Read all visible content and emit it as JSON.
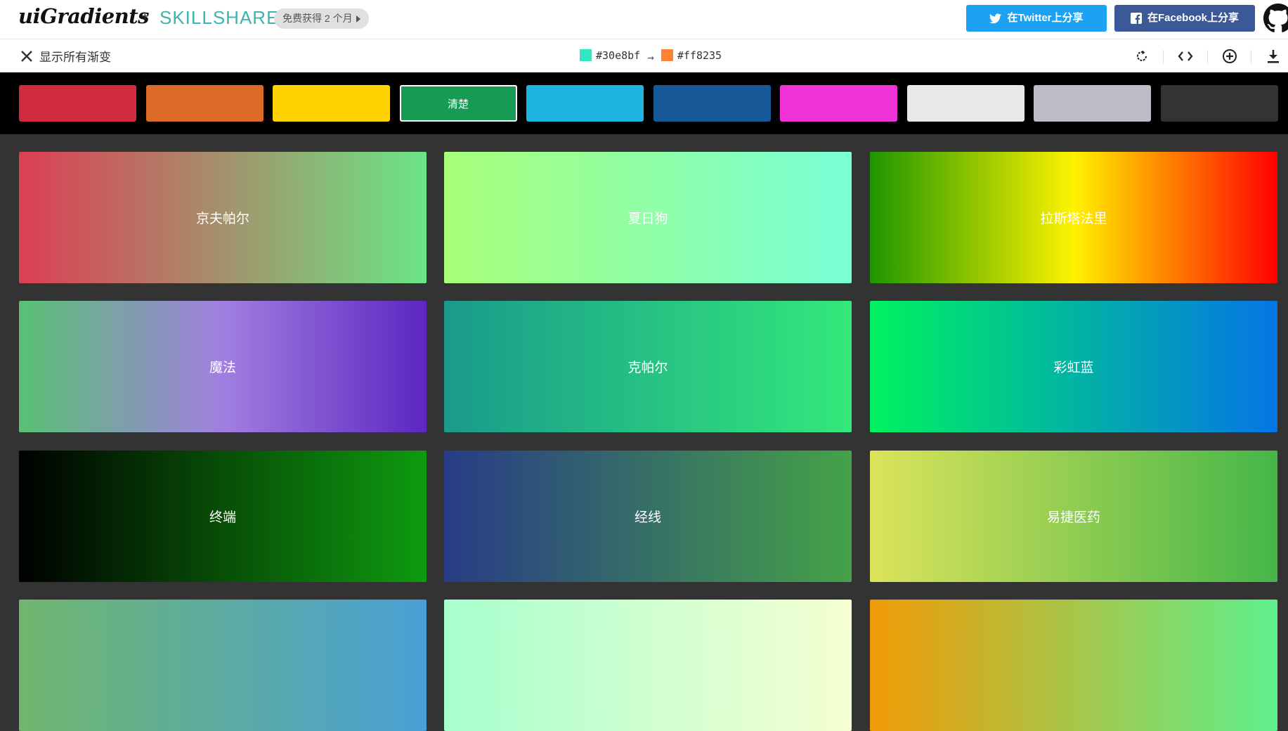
{
  "header": {
    "brand": "uiGradients",
    "plus": "+",
    "partner": "SKILLSHARE",
    "promo_label": "免费获得 2 个月",
    "share_twitter_label": "在Twitter上分享",
    "share_facebook_label": "在Facebook上分享",
    "icons": [
      "twitter-icon",
      "facebook-icon",
      "github-icon"
    ]
  },
  "toolbar": {
    "show_all_label": "显示所有渐变",
    "from_color": "#30e8bf",
    "to_color": "#ff8235",
    "arrow": "→",
    "tools": [
      "rotate-icon",
      "code-icon",
      "add-icon",
      "download-icon"
    ]
  },
  "filters": [
    {
      "color": "#d02b3e",
      "label": ""
    },
    {
      "color": "#dc6b27",
      "label": ""
    },
    {
      "color": "#ffd200",
      "label": ""
    },
    {
      "color": "#169b54",
      "label": "清楚",
      "active": true
    },
    {
      "color": "#1fb4e0",
      "label": ""
    },
    {
      "color": "#175899",
      "label": ""
    },
    {
      "color": "#f032d8",
      "label": ""
    },
    {
      "color": "#e8e8e8",
      "label": ""
    },
    {
      "color": "#bdbdc8",
      "label": ""
    },
    {
      "color": "#333333",
      "label": ""
    }
  ],
  "gradients": [
    {
      "name": "京夫帕尔",
      "colors": [
        "#dd3e54",
        "#6be585"
      ]
    },
    {
      "name": "夏日狗",
      "colors": [
        "#a8ff78",
        "#78ffd6"
      ]
    },
    {
      "name": "拉斯塔法里",
      "colors": [
        "#1e9600",
        "#fff200",
        "#ff0000"
      ]
    },
    {
      "name": "魔法",
      "colors": [
        "#59c173",
        "#a17fe0",
        "#5d26c1"
      ]
    },
    {
      "name": "克帕尔",
      "colors": [
        "#159957",
        "#155799"
      ],
      "display_colors": [
        "#1a9a8b",
        "#33e87b"
      ]
    },
    {
      "name": "彩虹蓝",
      "colors": [
        "#00f260",
        "#0575e6"
      ]
    },
    {
      "name": "终端",
      "colors": [
        "#000000",
        "#0f9b0f"
      ]
    },
    {
      "name": "经线",
      "colors": [
        "#283c86",
        "#45a247"
      ]
    },
    {
      "name": "易捷医药",
      "colors": [
        "#dce35b",
        "#45b649"
      ]
    },
    {
      "name": "",
      "colors": [
        "#70b66e",
        "#4aa0d6"
      ]
    },
    {
      "name": "",
      "colors": [
        "#a8ffce",
        "#f5ffd2"
      ]
    },
    {
      "name": "",
      "colors": [
        "#f19b06",
        "#5ef08c"
      ]
    }
  ]
}
